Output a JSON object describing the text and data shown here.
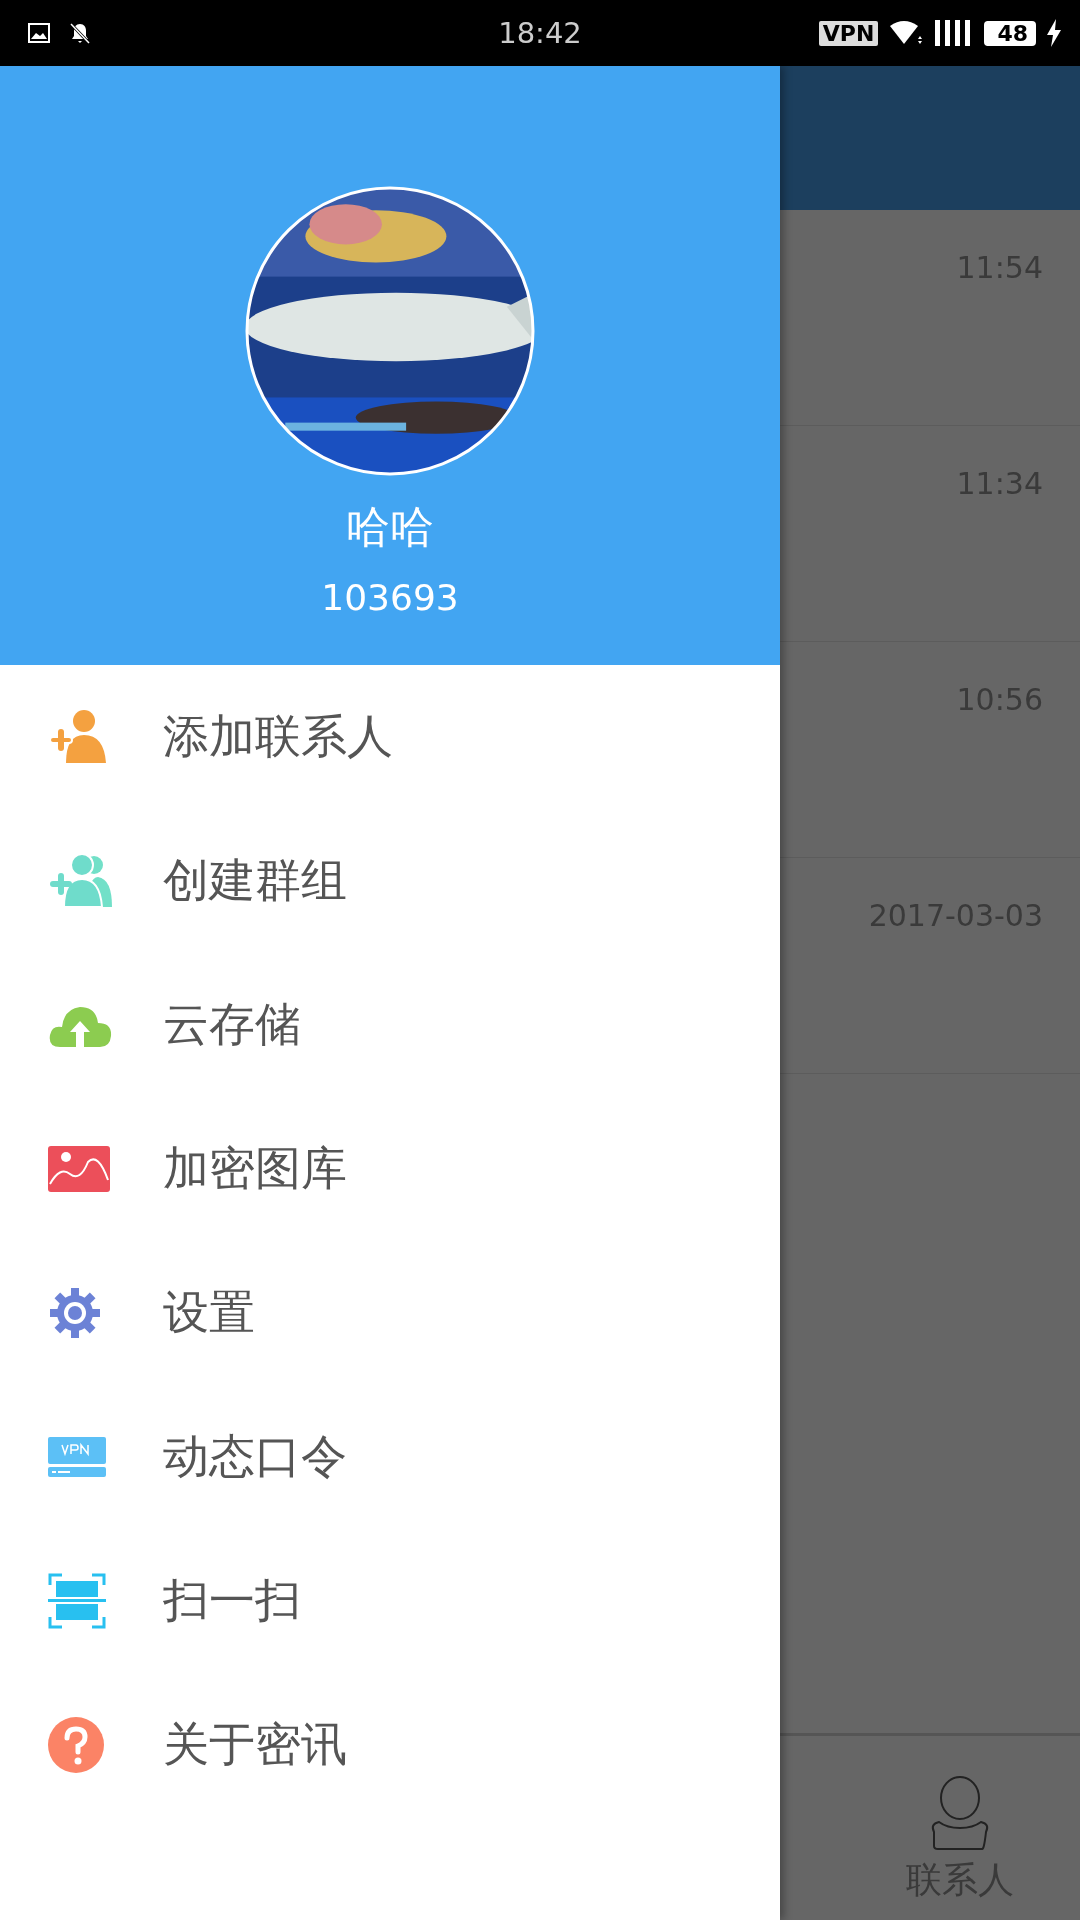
{
  "status_bar": {
    "time": "18:42",
    "vpn": "VPN",
    "battery": "48"
  },
  "drawer": {
    "profile": {
      "name": "哈哈",
      "id": "103693"
    },
    "menu": [
      {
        "kind": "add-contact",
        "label": "添加联系人"
      },
      {
        "kind": "create-group",
        "label": "创建群组"
      },
      {
        "kind": "cloud",
        "label": "云存储"
      },
      {
        "kind": "gallery",
        "label": "加密图库"
      },
      {
        "kind": "settings",
        "label": "设置"
      },
      {
        "kind": "vpn",
        "label": "动态口令"
      },
      {
        "kind": "scan",
        "label": "扫一扫"
      },
      {
        "kind": "about",
        "label": "关于密讯"
      }
    ]
  },
  "conversations": [
    {
      "time": "11:54"
    },
    {
      "time": "11:34"
    },
    {
      "time": "10:56"
    },
    {
      "time": "2017-03-03"
    }
  ],
  "bottom_nav": {
    "tab": "联系人"
  }
}
